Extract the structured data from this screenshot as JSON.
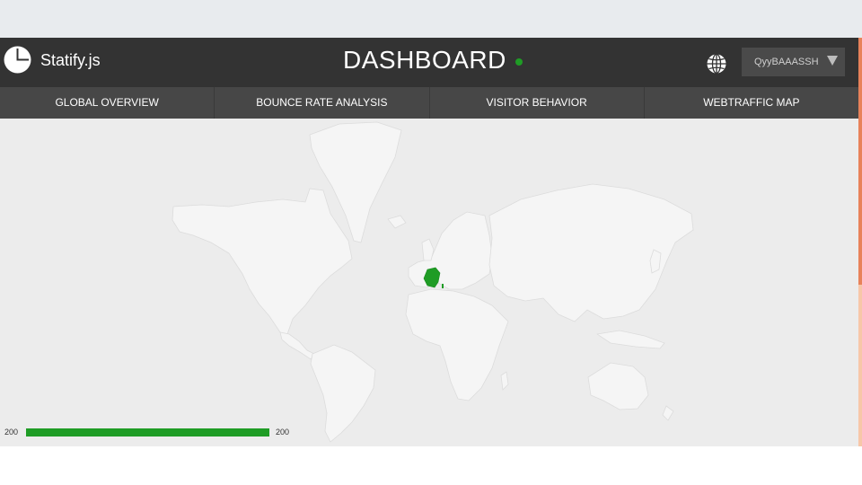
{
  "app": {
    "brand": "Statify.js",
    "title": "DASHBOARD",
    "user": "QyyBAAASSH"
  },
  "nav": {
    "tabs": [
      {
        "label": "GLOBAL OVERVIEW"
      },
      {
        "label": "BOUNCE RATE ANALYSIS"
      },
      {
        "label": "VISITOR BEHAVIOR"
      },
      {
        "label": "WEBTRAFFIC MAP"
      }
    ]
  },
  "map": {
    "highlighted_country": "France",
    "highlight_color": "#1f9c25",
    "land_color": "#f5f5f5",
    "border_color": "#dcdcdc",
    "water_color": "#ececec"
  },
  "legend": {
    "min": "200",
    "max": "200",
    "color": "#1f9c25"
  },
  "colors": {
    "header": "#333333",
    "nav": "#474747",
    "status": "#1f9c25",
    "scroll_accent": "#e8825a"
  }
}
